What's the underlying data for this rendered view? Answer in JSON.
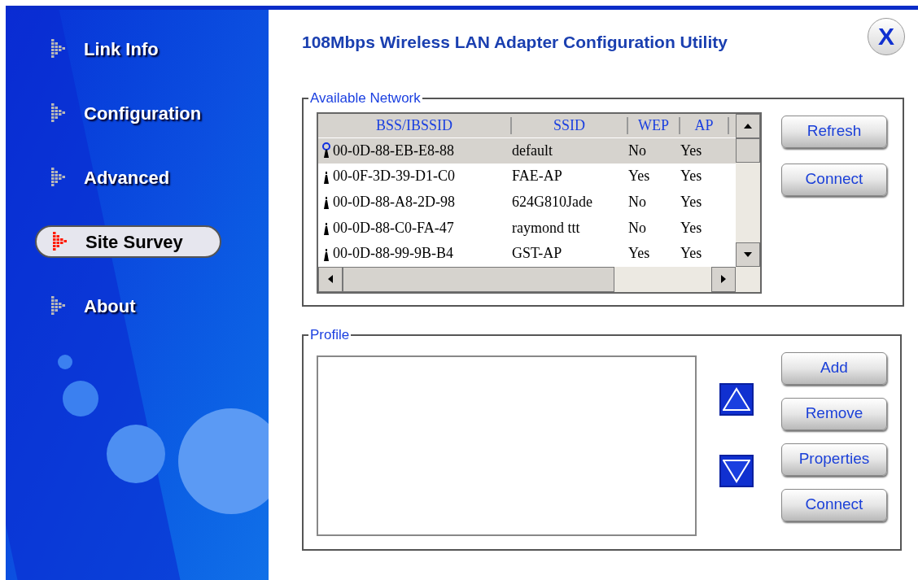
{
  "sidebar": {
    "items": [
      {
        "label": "Link Info",
        "selected": false
      },
      {
        "label": "Configuration",
        "selected": false
      },
      {
        "label": "Advanced",
        "selected": false
      },
      {
        "label": "Site Survey",
        "selected": true
      },
      {
        "label": "About",
        "selected": false
      }
    ]
  },
  "title": "108Mbps Wireless LAN Adapter Configuration Utility",
  "close_button": {
    "label": "X"
  },
  "available_network": {
    "legend": "Available Network",
    "columns": [
      "BSS/IBSSID",
      "SSID",
      "WEP",
      "AP"
    ],
    "rows": [
      {
        "bssid": "00-0D-88-EB-E8-88",
        "ssid": "default",
        "wep": "No",
        "ap": "Yes",
        "selected": true,
        "connected": true
      },
      {
        "bssid": "00-0F-3D-39-D1-C0",
        "ssid": "FAE-AP",
        "wep": "Yes",
        "ap": "Yes",
        "selected": false,
        "connected": false
      },
      {
        "bssid": "00-0D-88-A8-2D-98",
        "ssid": "624G810Jade",
        "wep": "No",
        "ap": "Yes",
        "selected": false,
        "connected": false
      },
      {
        "bssid": "00-0D-88-C0-FA-47",
        "ssid": "raymond ttt",
        "wep": "No",
        "ap": "Yes",
        "selected": false,
        "connected": false
      },
      {
        "bssid": "00-0D-88-99-9B-B4",
        "ssid": "GST-AP",
        "wep": "Yes",
        "ap": "Yes",
        "selected": false,
        "connected": false
      }
    ],
    "buttons": [
      "Refresh",
      "Connect"
    ]
  },
  "profile": {
    "legend": "Profile",
    "buttons": [
      "Add",
      "Remove",
      "Properties",
      "Connect"
    ]
  }
}
